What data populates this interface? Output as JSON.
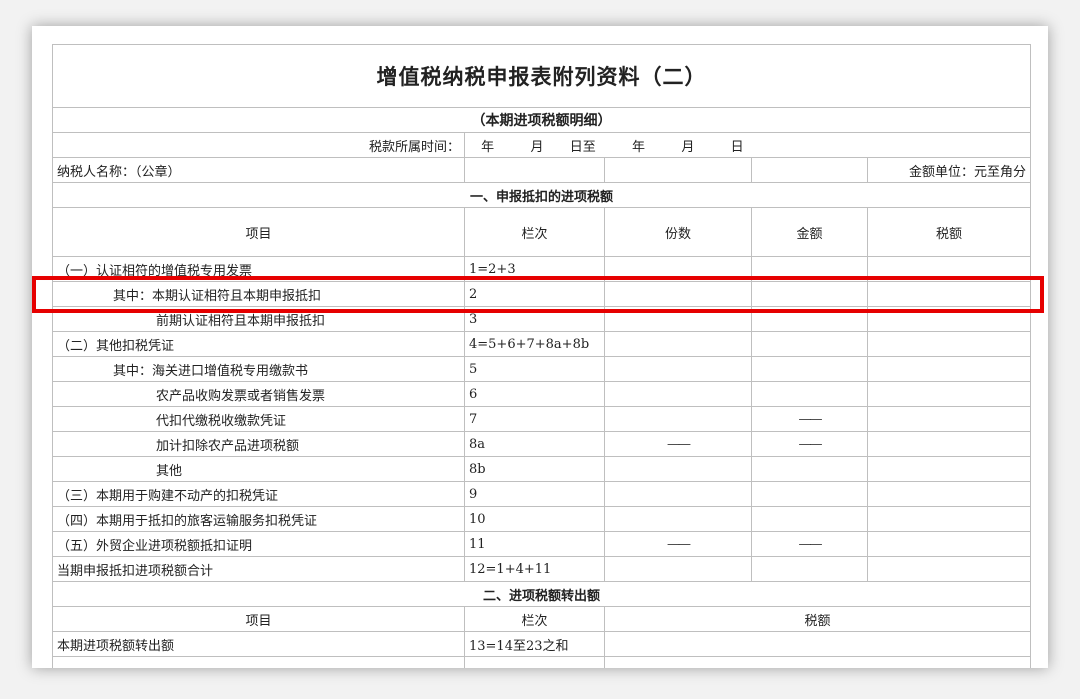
{
  "title": "增值税纳税申报表附列资料（二）",
  "subtitle": "（本期进项税额明细）",
  "period_label": "税款所属时间：",
  "period_parts": [
    "年",
    "月",
    "日至",
    "年",
    "月",
    "日"
  ],
  "taxpayer_label": "纳税人名称：（公章）",
  "unit_label": "金额单位：元至角分",
  "section1": {
    "heading": "一、申报抵扣的进项税额",
    "col_item": "项目",
    "col_line": "栏次",
    "col_count": "份数",
    "col_amount": "金额",
    "col_tax": "税额",
    "rows": [
      {
        "item": "（一）认证相符的增值税专用发票",
        "line": "1=2+3",
        "count": "",
        "amount": "",
        "tax": ""
      },
      {
        "item": "其中：本期认证相符且本期申报抵扣",
        "line": "2",
        "count": "",
        "amount": "",
        "tax": ""
      },
      {
        "item": "前期认证相符且本期申报抵扣",
        "line": "3",
        "count": "",
        "amount": "",
        "tax": ""
      },
      {
        "item": "（二）其他扣税凭证",
        "line": "4=5+6+7+8a+8b",
        "count": "",
        "amount": "",
        "tax": ""
      },
      {
        "item": "其中：海关进口增值税专用缴款书",
        "line": "5",
        "count": "",
        "amount": "",
        "tax": ""
      },
      {
        "item": "农产品收购发票或者销售发票",
        "line": "6",
        "count": "",
        "amount": "",
        "tax": ""
      },
      {
        "item": "代扣代缴税收缴款凭证",
        "line": "7",
        "count": "",
        "amount": "——",
        "tax": ""
      },
      {
        "item": "加计扣除农产品进项税额",
        "line": "8a",
        "count": "——",
        "amount": "——",
        "tax": ""
      },
      {
        "item": "其他",
        "line": "8b",
        "count": "",
        "amount": "",
        "tax": ""
      },
      {
        "item": "（三）本期用于购建不动产的扣税凭证",
        "line": "9",
        "count": "",
        "amount": "",
        "tax": ""
      },
      {
        "item": "（四）本期用于抵扣的旅客运输服务扣税凭证",
        "line": "10",
        "count": "",
        "amount": "",
        "tax": ""
      },
      {
        "item": "（五）外贸企业进项税额抵扣证明",
        "line": "11",
        "count": "——",
        "amount": "——",
        "tax": ""
      },
      {
        "item": "当期申报抵扣进项税额合计",
        "line": "12=1+4+11",
        "count": "",
        "amount": "",
        "tax": ""
      }
    ]
  },
  "section2": {
    "heading": "二、进项税额转出额",
    "col_item": "项目",
    "col_line": "栏次",
    "col_tax": "税额",
    "rows": [
      {
        "item": "本期进项税额转出额",
        "line": "13=14至23之和",
        "tax": ""
      }
    ]
  },
  "colors": {
    "highlight": "#e60000",
    "grid": "#bfbfbf",
    "marker": "#1e8a3a"
  }
}
